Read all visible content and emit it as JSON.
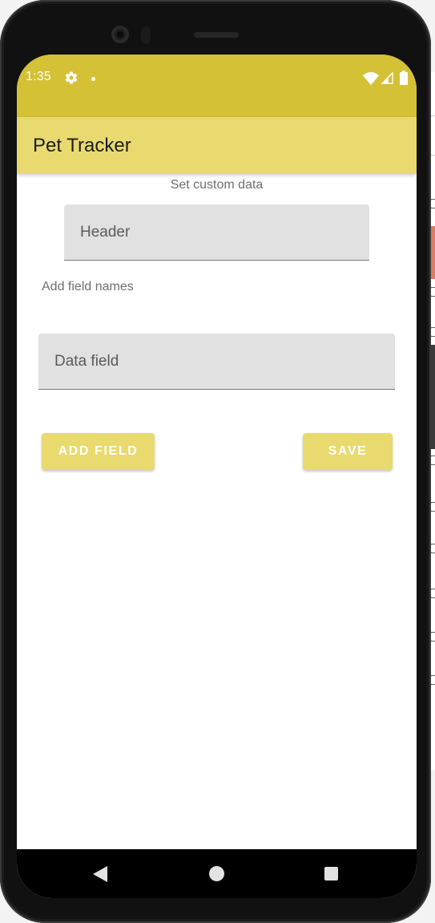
{
  "status_bar": {
    "time": "1:35",
    "icons": [
      "gear-icon",
      "notification-dot",
      "wifi-icon",
      "signal-icon",
      "battery-icon"
    ],
    "color": "#d4c136"
  },
  "app_bar": {
    "title": "Pet Tracker",
    "color": "#e8da6e"
  },
  "form": {
    "set_custom_data_label": "Set custom data",
    "header_input": {
      "placeholder": "Header",
      "value": ""
    },
    "add_field_names_label": "Add field names",
    "data_field_input": {
      "placeholder": "Data field",
      "value": ""
    },
    "add_field_button": "ADD FIELD",
    "save_button": "SAVE"
  },
  "nav_bar": {
    "buttons": [
      "back-icon",
      "home-icon",
      "recents-icon"
    ]
  },
  "colors": {
    "accent": "#e8da6e",
    "button_text": "#ffffff"
  }
}
